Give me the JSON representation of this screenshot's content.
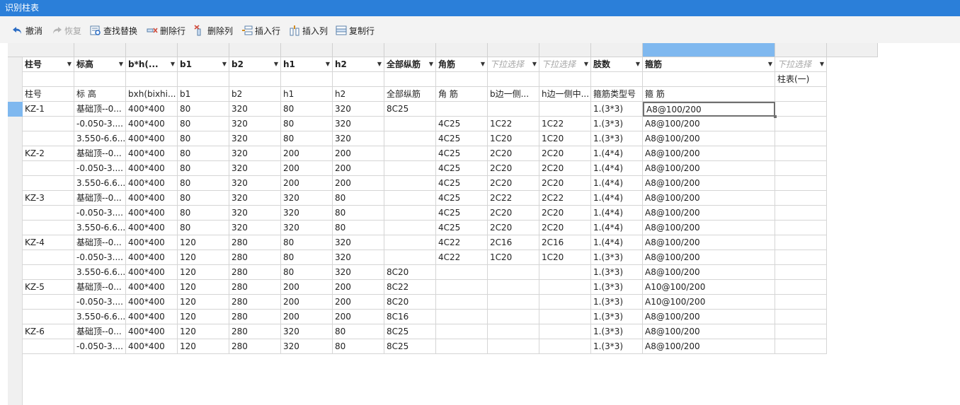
{
  "window": {
    "title": "识别柱表"
  },
  "toolbar": {
    "undo": "撤消",
    "redo": "恢复",
    "find_replace": "查找替换",
    "delete_row": "删除行",
    "delete_col": "删除列",
    "insert_row": "插入行",
    "insert_col": "插入列",
    "copy_row": "复制行"
  },
  "table": {
    "header": [
      "柱号",
      "标高",
      "b*h(...",
      "b1",
      "b2",
      "h1",
      "h2",
      "全部纵筋",
      "角筋",
      "下拉选择",
      "下拉选择",
      "肢数",
      "箍筋",
      "下拉选择"
    ],
    "placeholder_cols": [
      9,
      10,
      13
    ],
    "row2": [
      "",
      "",
      "",
      "",
      "",
      "",
      "",
      "",
      "",
      "",
      "",
      "",
      "",
      "柱表(一)"
    ],
    "row3": [
      "柱号",
      "标 高",
      "bxh(bixhi...",
      "b1",
      "b2",
      "h1",
      "h2",
      "全部纵筋",
      "角 筋",
      "b边一侧...",
      "h边一侧中...",
      "箍筋类型号",
      "箍  筋",
      ""
    ],
    "rows": [
      [
        "KZ-1",
        "基础顶--0...",
        "400*400",
        "80",
        "320",
        "80",
        "320",
        "8C25",
        "",
        "",
        "",
        "1.(3*3)",
        "A8@100/200",
        ""
      ],
      [
        "",
        "-0.050-3....",
        "400*400",
        "80",
        "320",
        "80",
        "320",
        "",
        "4C25",
        "1C22",
        "1C22",
        "1.(3*3)",
        "A8@100/200",
        ""
      ],
      [
        "",
        "3.550-6.6...",
        "400*400",
        "80",
        "320",
        "80",
        "320",
        "",
        "4C25",
        "1C20",
        "1C20",
        "1.(3*3)",
        "A8@100/200",
        ""
      ],
      [
        "KZ-2",
        "基础顶--0...",
        "400*400",
        "80",
        "320",
        "200",
        "200",
        "",
        "4C25",
        "2C20",
        "2C20",
        "1.(4*4)",
        "A8@100/200",
        ""
      ],
      [
        "",
        "-0.050-3....",
        "400*400",
        "80",
        "320",
        "200",
        "200",
        "",
        "4C25",
        "2C20",
        "2C20",
        "1.(4*4)",
        "A8@100/200",
        ""
      ],
      [
        "",
        "3.550-6.6...",
        "400*400",
        "80",
        "320",
        "200",
        "200",
        "",
        "4C25",
        "2C20",
        "2C20",
        "1.(4*4)",
        "A8@100/200",
        ""
      ],
      [
        "KZ-3",
        "基础顶--0...",
        "400*400",
        "80",
        "320",
        "320",
        "80",
        "",
        "4C25",
        "2C22",
        "2C22",
        "1.(4*4)",
        "A8@100/200",
        ""
      ],
      [
        "",
        "-0.050-3....",
        "400*400",
        "80",
        "320",
        "320",
        "80",
        "",
        "4C25",
        "2C20",
        "2C20",
        "1.(4*4)",
        "A8@100/200",
        ""
      ],
      [
        "",
        "3.550-6.6...",
        "400*400",
        "80",
        "320",
        "320",
        "80",
        "",
        "4C25",
        "2C20",
        "2C20",
        "1.(4*4)",
        "A8@100/200",
        ""
      ],
      [
        "KZ-4",
        "基础顶--0...",
        "400*400",
        "120",
        "280",
        "80",
        "320",
        "",
        "4C22",
        "2C16",
        "2C16",
        "1.(4*4)",
        "A8@100/200",
        ""
      ],
      [
        "",
        "-0.050-3....",
        "400*400",
        "120",
        "280",
        "80",
        "320",
        "",
        "4C22",
        "1C20",
        "1C20",
        "1.(3*3)",
        "A8@100/200",
        ""
      ],
      [
        "",
        "3.550-6.6...",
        "400*400",
        "120",
        "280",
        "80",
        "320",
        "8C20",
        "",
        "",
        "",
        "1.(3*3)",
        "A8@100/200",
        ""
      ],
      [
        "KZ-5",
        "基础顶--0...",
        "400*400",
        "120",
        "280",
        "200",
        "200",
        "8C22",
        "",
        "",
        "",
        "1.(3*3)",
        "A10@100/200",
        ""
      ],
      [
        "",
        "-0.050-3....",
        "400*400",
        "120",
        "280",
        "200",
        "200",
        "8C20",
        "",
        "",
        "",
        "1.(3*3)",
        "A10@100/200",
        ""
      ],
      [
        "",
        "3.550-6.6...",
        "400*400",
        "120",
        "280",
        "200",
        "200",
        "8C16",
        "",
        "",
        "",
        "1.(3*3)",
        "A8@100/200",
        ""
      ],
      [
        "KZ-6",
        "基础顶--0...",
        "400*400",
        "120",
        "280",
        "320",
        "80",
        "8C25",
        "",
        "",
        "",
        "1.(3*3)",
        "A8@100/200",
        ""
      ],
      [
        "",
        "-0.050-3....",
        "400*400",
        "120",
        "280",
        "320",
        "80",
        "8C25",
        "",
        "",
        "",
        "1.(3*3)",
        "A8@100/200",
        ""
      ]
    ],
    "selected": {
      "row": 0,
      "col": 12
    }
  },
  "colors": {
    "title_bar": "#2b7fd9",
    "selection": "#7fb8ef",
    "undo_icon": "#2b6cc4",
    "delete_icon": "#d04a3a"
  }
}
